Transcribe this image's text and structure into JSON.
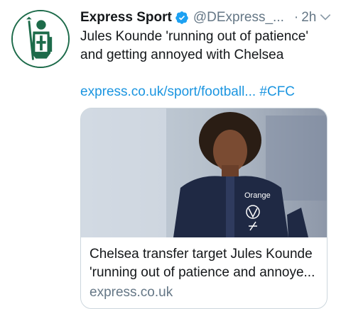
{
  "tweet": {
    "author_name": "Express Sport",
    "handle": "@DExpress_...",
    "separator": "·",
    "time": "2h",
    "text": "Jules Kounde 'running out of patience' and getting annoyed with Chelsea",
    "link": "express.co.uk/sport/football...",
    "hashtag": "#CFC"
  },
  "card": {
    "title": "Chelsea transfer target Jules Kounde\n'running out of patience and annoye...",
    "domain": "express.co.uk",
    "shirt_text": "Orange"
  },
  "icons": {
    "avatar": "crusader-logo",
    "verified": "verified-badge-icon",
    "menu": "chevron-down-icon"
  },
  "colors": {
    "link": "#1b95e0",
    "muted": "#657786",
    "logo_green": "#1d6b4a"
  }
}
